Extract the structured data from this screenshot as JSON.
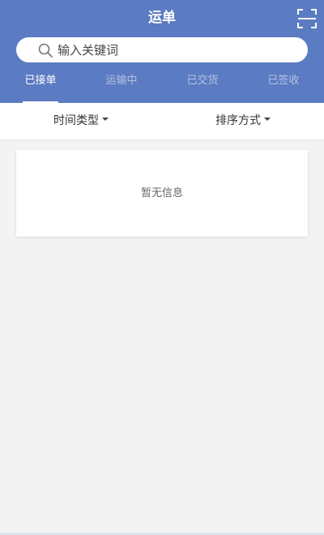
{
  "header": {
    "title": "运单",
    "scan_icon": "scan-icon",
    "background_color": "#5b7bc2"
  },
  "search": {
    "placeholder": "输入关键词",
    "value": "",
    "icon": "search-icon"
  },
  "tabs": [
    {
      "label": "已接单",
      "active": true
    },
    {
      "label": "运输中",
      "active": false
    },
    {
      "label": "已交货",
      "active": false
    },
    {
      "label": "已签收",
      "active": false
    }
  ],
  "filters": [
    {
      "label": "时间类型",
      "icon": "caret-down-icon"
    },
    {
      "label": "排序方式",
      "icon": "caret-down-icon"
    }
  ],
  "list": {
    "empty_message": "暂无信息"
  }
}
